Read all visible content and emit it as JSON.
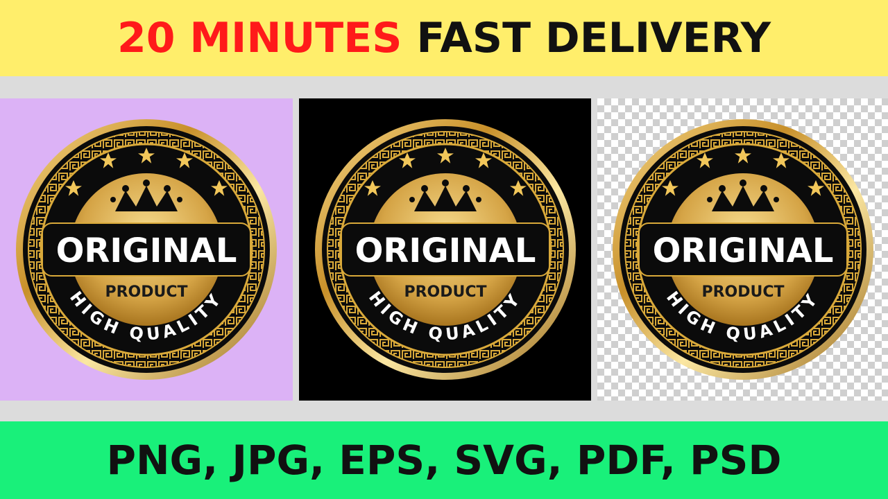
{
  "header": {
    "headline_accent": "20 MINUTES",
    "headline_rest": "FAST DELIVERY"
  },
  "badge": {
    "main_text": "ORIGINAL",
    "sub_text": "PRODUCT",
    "arc_text": "HIGH QUALITY"
  },
  "panels": [
    {
      "background": "purple"
    },
    {
      "background": "black"
    },
    {
      "background": "transparent-checker"
    }
  ],
  "footer": {
    "formats": "PNG, JPG, EPS, SVG, PDF, PSD"
  },
  "colors": {
    "top_banner": "#ffee6b",
    "accent_red": "#ff1a1a",
    "bottom_banner": "#19f07a",
    "gold": "#d9a93a",
    "badge_black": "#0b0b0b"
  }
}
